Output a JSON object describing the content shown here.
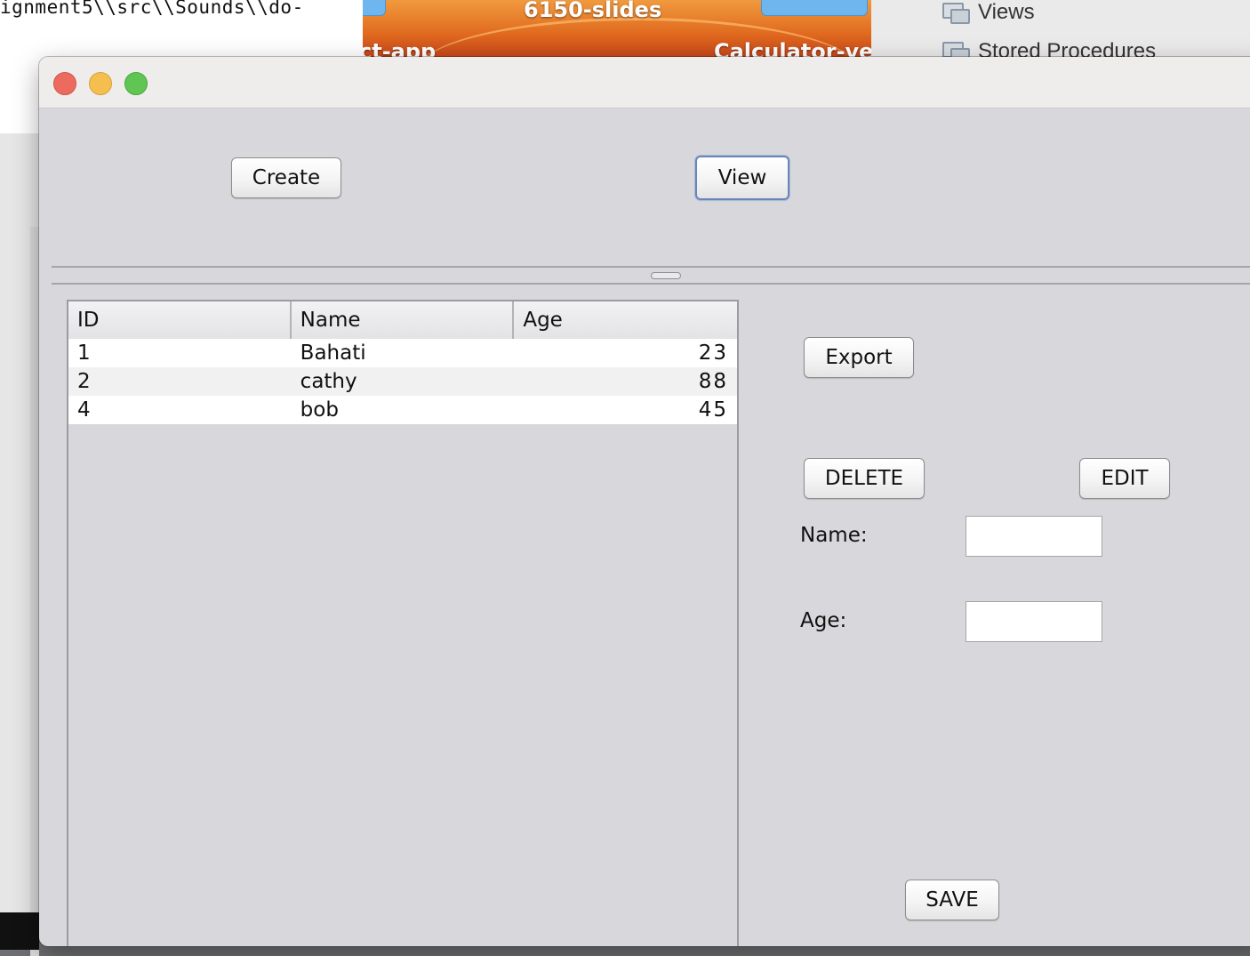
{
  "background": {
    "terminal_text": "ignment5\\\\src\\\\Sounds\\\\do-",
    "desktop_folder_title": "6150-slides",
    "desktop_folder_left": "ct-app",
    "desktop_folder_right": "Calculator-ver:",
    "sidebar_items": [
      {
        "label": "Views",
        "icon": "database-view-icon"
      },
      {
        "label": "Stored Procedures",
        "icon": "database-procedure-icon"
      }
    ]
  },
  "window": {
    "toolbar": {
      "create_label": "Create",
      "view_label": "View"
    },
    "table": {
      "columns": [
        "ID",
        "Name",
        "Age"
      ],
      "rows": [
        {
          "id": "1",
          "name": "Bahati",
          "age": "23"
        },
        {
          "id": "2",
          "name": "cathy",
          "age": "88"
        },
        {
          "id": "4",
          "name": "bob",
          "age": "45"
        }
      ]
    },
    "actions": {
      "export_label": "Export",
      "delete_label": "DELETE",
      "edit_label": "EDIT",
      "save_label": "SAVE"
    },
    "form": {
      "name_label": "Name:",
      "name_value": "",
      "age_label": "Age:",
      "age_value": ""
    }
  },
  "colors": {
    "close": "#ed6a5e",
    "minimize": "#f4bf4f",
    "maximize": "#61c554",
    "window_bg": "#d8d8dc"
  }
}
